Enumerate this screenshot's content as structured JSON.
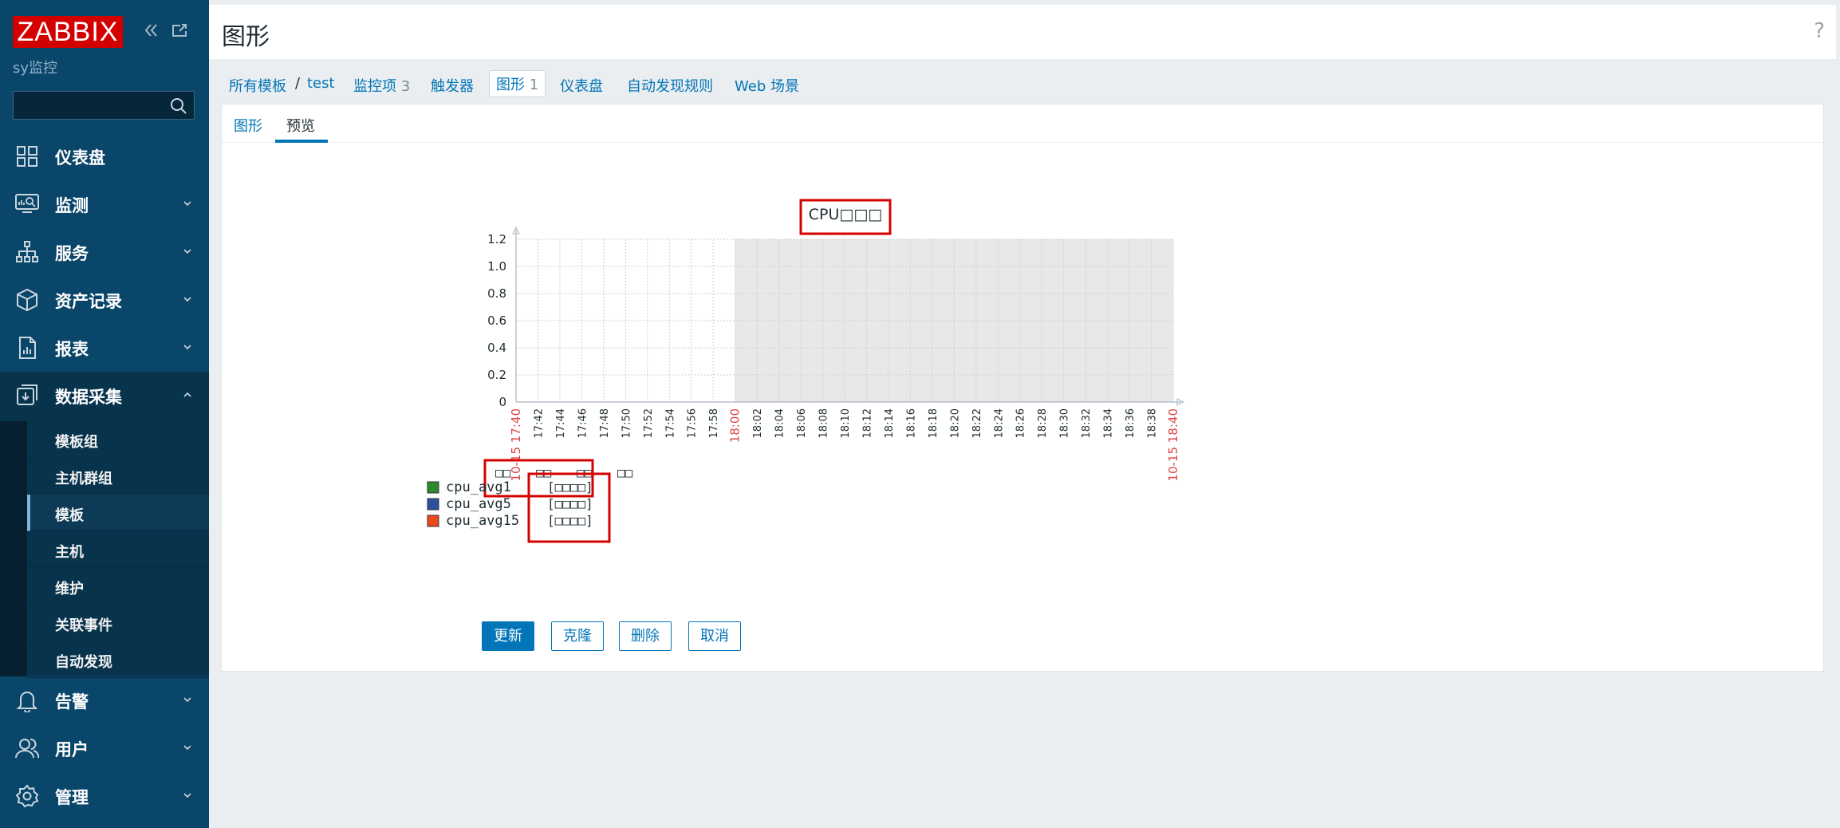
{
  "app": {
    "logo": "ZABBIX",
    "server_name": "sy监控",
    "collapse_icon": "chevrons-left-icon",
    "kiosk_icon": "fullscreen-icon"
  },
  "search": {
    "value": "",
    "placeholder": ""
  },
  "nav": [
    {
      "label": "仪表盘",
      "icon": "dashboard-icon",
      "expandable": false
    },
    {
      "label": "监测",
      "icon": "monitoring-icon",
      "expandable": true
    },
    {
      "label": "服务",
      "icon": "services-icon",
      "expandable": true
    },
    {
      "label": "资产记录",
      "icon": "inventory-icon",
      "expandable": true
    },
    {
      "label": "报表",
      "icon": "reports-icon",
      "expandable": true
    },
    {
      "label": "数据采集",
      "icon": "data-collection-icon",
      "expandable": true,
      "expanded": true
    },
    {
      "label": "告警",
      "icon": "alerts-icon",
      "expandable": true
    },
    {
      "label": "用户",
      "icon": "users-icon",
      "expandable": true
    },
    {
      "label": "管理",
      "icon": "administration-icon",
      "expandable": true
    }
  ],
  "submenu": [
    "模板组",
    "主机群组",
    "模板",
    "主机",
    "维护",
    "关联事件",
    "自动发现"
  ],
  "submenu_selected": "模板",
  "header": {
    "title": "图形",
    "help": "?"
  },
  "breadcrumbs": {
    "all_templates": "所有模板",
    "sep": "/",
    "template": "test",
    "items_label": "监控项",
    "items_count": "3",
    "triggers": "触发器",
    "graphs_label": "图形",
    "graphs_count": "1",
    "dashboards": "仪表盘",
    "discovery": "自动发现规则",
    "web": "Web 场景"
  },
  "subtabs": {
    "graph": "图形",
    "preview": "预览"
  },
  "chart_data": {
    "type": "line",
    "title": "CPU□□□",
    "x": [
      "17:40",
      "17:42",
      "17:44",
      "17:46",
      "17:48",
      "17:50",
      "17:52",
      "17:54",
      "17:56",
      "17:58",
      "18:00",
      "18:02",
      "18:04",
      "18:06",
      "18:08",
      "18:10",
      "18:12",
      "18:14",
      "18:16",
      "18:18",
      "18:20",
      "18:22",
      "18:24",
      "18:26",
      "18:28",
      "18:30",
      "18:32",
      "18:34",
      "18:36",
      "18:38",
      "18:40"
    ],
    "x_start_label": "10-15 17:40",
    "x_end_label": "10-15 18:40",
    "highlight_tick": "18:00",
    "y_ticks": [
      "0",
      "0.2",
      "0.4",
      "0.6",
      "0.8",
      "1.0",
      "1.2"
    ],
    "ylim": [
      0,
      1.2
    ],
    "shaded_from": "18:00",
    "grid": true,
    "legend_headers": [
      "□□",
      "□□",
      "□□",
      "□□"
    ],
    "series": [
      {
        "name": "cpu_avg1",
        "color": "#2b8a2b",
        "tag": "[□□□□]",
        "values": []
      },
      {
        "name": "cpu_avg5",
        "color": "#2e4fa0",
        "tag": "[□□□□]",
        "values": []
      },
      {
        "name": "cpu_avg15",
        "color": "#e8481c",
        "tag": "[□□□□]",
        "values": []
      }
    ]
  },
  "buttons": {
    "update": "更新",
    "clone": "克隆",
    "delete": "删除",
    "cancel": "取消"
  },
  "colors": {
    "sidebar": "#0a466a",
    "link": "#0275b8",
    "highlight": "#e04545",
    "annotation_box": "#d40000"
  }
}
